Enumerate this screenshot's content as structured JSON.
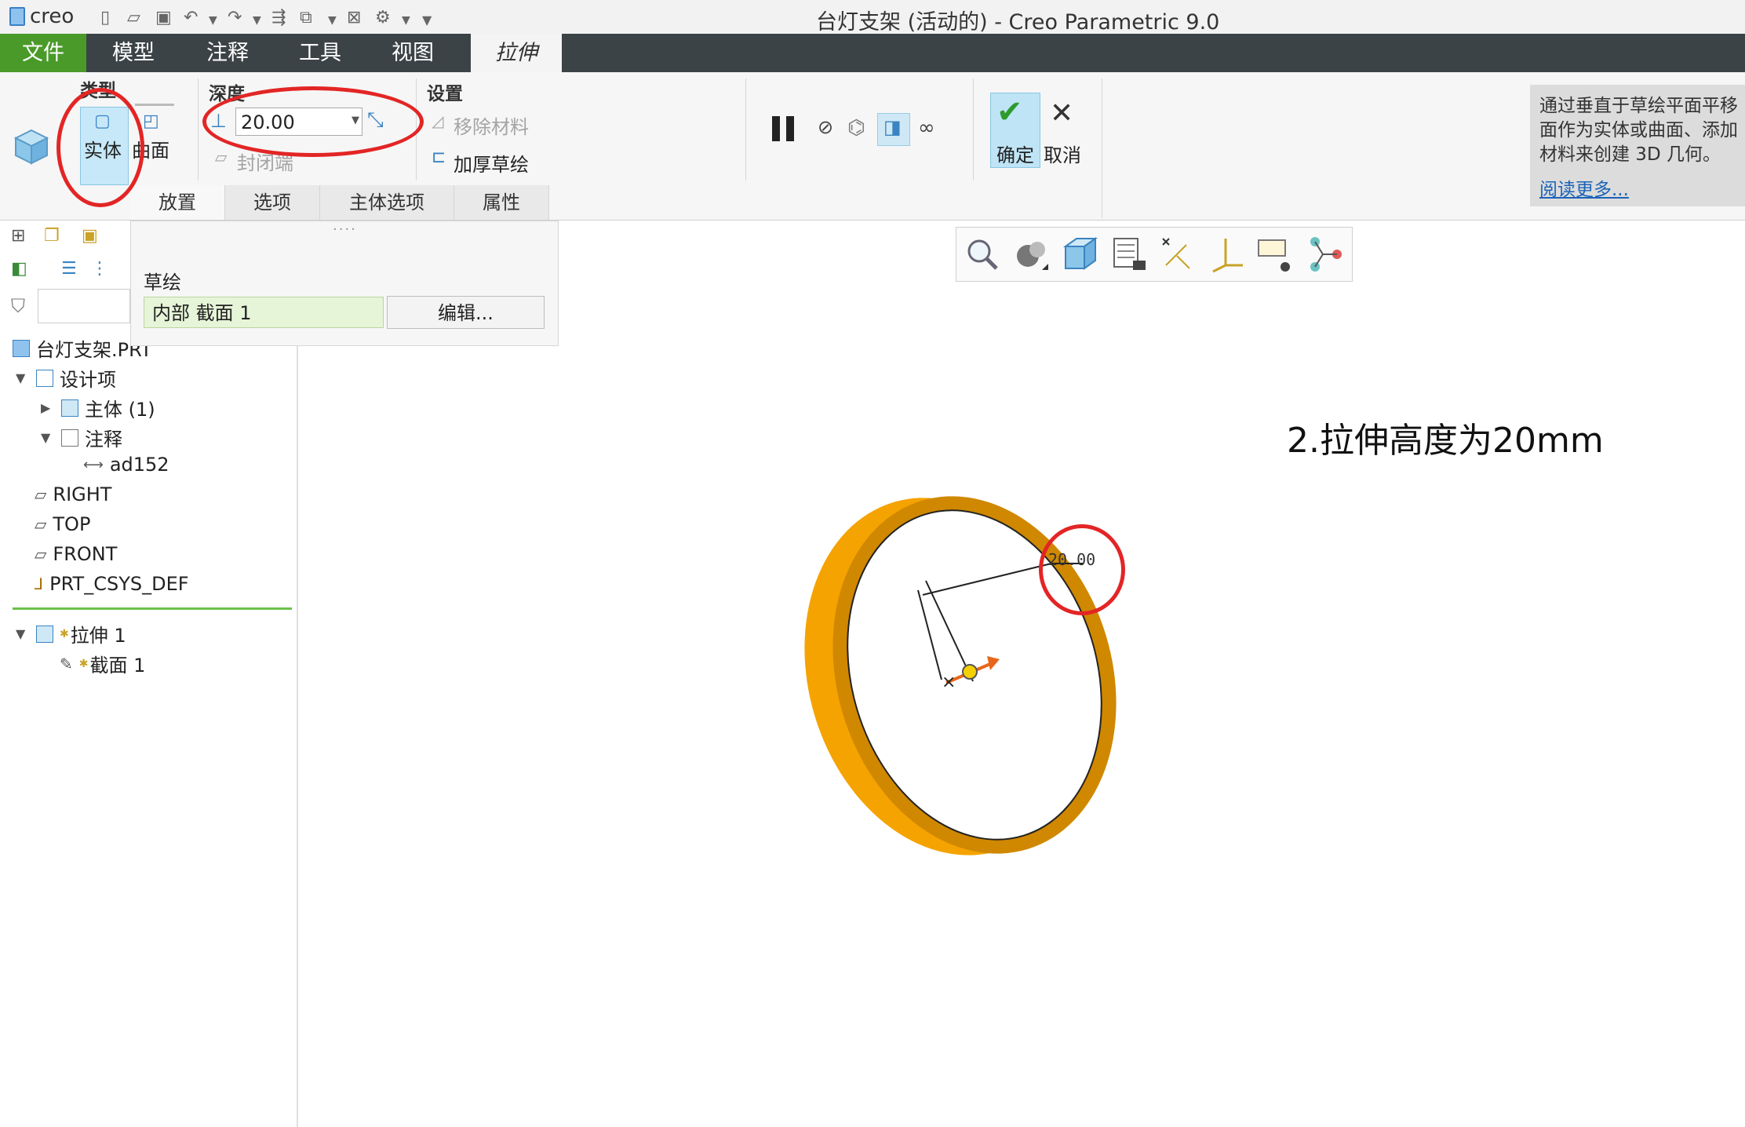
{
  "app": {
    "logo_text": "creo",
    "window_title": "台灯支架 (活动的) - Creo Parametric 9.0"
  },
  "menu": {
    "items": [
      "文件",
      "模型",
      "注释",
      "工具",
      "视图",
      "拉伸"
    ]
  },
  "ribbon": {
    "type_group": {
      "label": "类型",
      "solid": "实体",
      "surface": "曲面"
    },
    "depth_group": {
      "label": "深度",
      "value": "20.00",
      "capped_ends": "封闭端"
    },
    "settings_group": {
      "label": "设置",
      "remove_material": "移除材料",
      "thicken_sketch": "加厚草绘"
    },
    "ok": "确定",
    "cancel": "取消",
    "tabs": [
      "放置",
      "选项",
      "主体选项",
      "属性"
    ]
  },
  "help": {
    "text": "通过垂直于草绘平面平移面作为实体或曲面、添加材料来创建 3D 几何。",
    "link": "阅读更多..."
  },
  "placement_popup": {
    "title": "草绘",
    "field_value": "内部 截面 1",
    "edit_button": "编辑..."
  },
  "tree": {
    "root": "台灯支架.PRT",
    "items": [
      {
        "label": "设计项"
      },
      {
        "label": "主体 (1)"
      },
      {
        "label": "注释"
      },
      {
        "label": "ad152"
      },
      {
        "label": "RIGHT"
      },
      {
        "label": "TOP"
      },
      {
        "label": "FRONT"
      },
      {
        "label": "PRT_CSYS_DEF"
      },
      {
        "label": "拉伸 1"
      },
      {
        "label": "截面 1"
      }
    ]
  },
  "model": {
    "dimension": "20.00",
    "color": "#f5a300"
  },
  "annotation": "2.拉伸高度为20mm"
}
